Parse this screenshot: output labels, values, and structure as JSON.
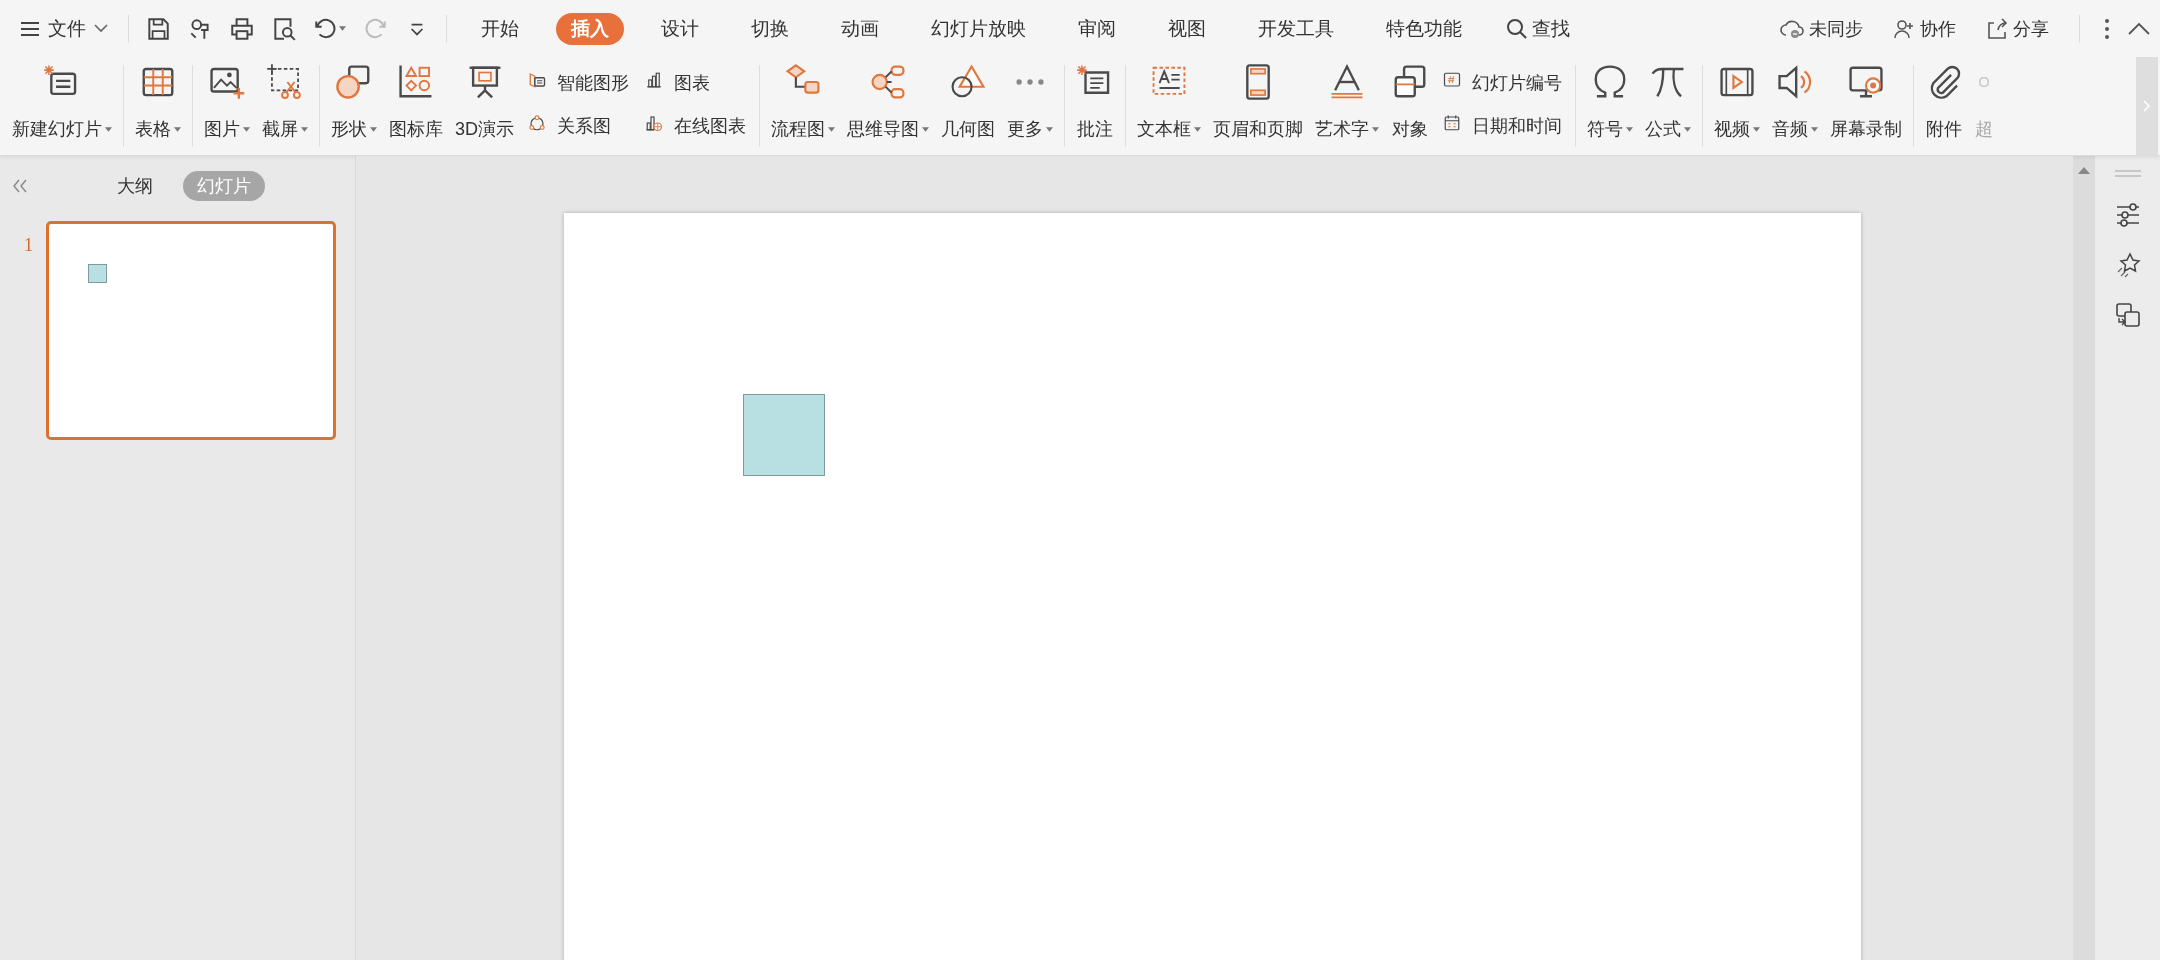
{
  "menu": {
    "label": "文件"
  },
  "quick_access": [
    {
      "disabled": false
    },
    {
      "disabled": false
    },
    {
      "disabled": false
    },
    {
      "disabled": false
    },
    {
      "disabled": false
    },
    {
      "disabled": true
    },
    {
      "disabled": false
    }
  ],
  "tabs": [
    {
      "label": "开始",
      "selected": false
    },
    {
      "label": "插入",
      "selected": true
    },
    {
      "label": "设计",
      "selected": false
    },
    {
      "label": "切换",
      "selected": false
    },
    {
      "label": "动画",
      "selected": false
    },
    {
      "label": "幻灯片放映",
      "selected": false
    },
    {
      "label": "审阅",
      "selected": false
    },
    {
      "label": "视图",
      "selected": false
    },
    {
      "label": "开发工具",
      "selected": false
    },
    {
      "label": "特色功能",
      "selected": false
    }
  ],
  "search": {
    "label": "查找"
  },
  "account_actions": [
    {
      "label": "未同步"
    },
    {
      "label": "协作"
    },
    {
      "label": "分享"
    }
  ],
  "ribbon": {
    "groups": [
      {
        "items": [
          {
            "kind": "large",
            "label": "新建幻灯片",
            "dropdown": true
          }
        ]
      },
      {
        "items": [
          {
            "kind": "large",
            "label": "表格",
            "dropdown": true
          }
        ]
      },
      {
        "items": [
          {
            "kind": "large",
            "label": "图片",
            "dropdown": true
          },
          {
            "kind": "large",
            "label": "截屏",
            "dropdown": true
          }
        ]
      },
      {
        "items": [
          {
            "kind": "large",
            "label": "形状",
            "dropdown": true
          },
          {
            "kind": "large",
            "label": "图标库",
            "dropdown": false
          },
          {
            "kind": "large",
            "label": "3D演示",
            "dropdown": false
          },
          {
            "kind": "pair",
            "items": [
              {
                "label": "智能图形"
              },
              {
                "label": "关系图"
              }
            ]
          },
          {
            "kind": "pair",
            "items": [
              {
                "label": "图表"
              },
              {
                "label": "在线图表"
              }
            ]
          }
        ]
      },
      {
        "items": [
          {
            "kind": "large",
            "label": "流程图",
            "dropdown": true
          },
          {
            "kind": "large",
            "label": "思维导图",
            "dropdown": true
          },
          {
            "kind": "large",
            "label": "几何图",
            "dropdown": false
          },
          {
            "kind": "large",
            "label": "更多",
            "dropdown": true
          }
        ]
      },
      {
        "items": [
          {
            "kind": "large",
            "label": "批注",
            "dropdown": false
          }
        ]
      },
      {
        "items": [
          {
            "kind": "large",
            "label": "文本框",
            "dropdown": true
          },
          {
            "kind": "large",
            "label": "页眉和页脚",
            "dropdown": false
          },
          {
            "kind": "large",
            "label": "艺术字",
            "dropdown": true
          },
          {
            "kind": "large",
            "label": "对象",
            "dropdown": false
          },
          {
            "kind": "pair",
            "items": [
              {
                "label": "幻灯片编号"
              },
              {
                "label": "日期和时间"
              }
            ]
          }
        ]
      },
      {
        "items": [
          {
            "kind": "large",
            "label": "符号",
            "dropdown": true
          },
          {
            "kind": "large",
            "label": "公式",
            "dropdown": true
          }
        ]
      },
      {
        "items": [
          {
            "kind": "large",
            "label": "视频",
            "dropdown": true
          },
          {
            "kind": "large",
            "label": "音频",
            "dropdown": true
          },
          {
            "kind": "large",
            "label": "屏幕录制",
            "dropdown": false
          }
        ]
      },
      {
        "items": [
          {
            "kind": "large",
            "label": "附件",
            "dropdown": false
          }
        ]
      }
    ],
    "overflow_item": {
      "label": "超"
    }
  },
  "panel": {
    "tabs": [
      {
        "label": "大纲",
        "selected": false
      },
      {
        "label": "幻灯片",
        "selected": true
      }
    ],
    "slides": [
      {
        "number": "1",
        "selected": true
      }
    ]
  }
}
